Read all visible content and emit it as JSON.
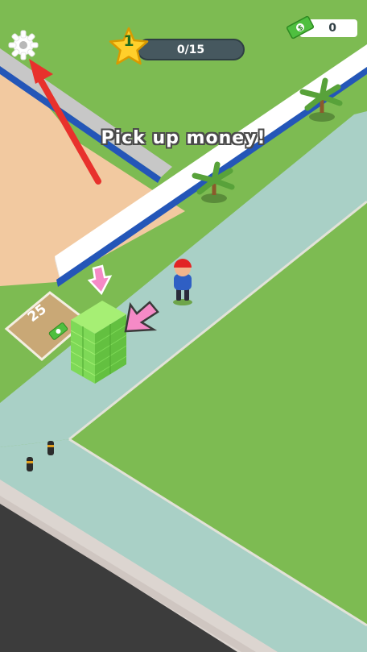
{
  "hud": {
    "level": "1",
    "progress_text": "0/15",
    "progress_fraction": 0.0,
    "cash": "0"
  },
  "hint": {
    "text": "Pick up money!"
  },
  "unlock_pad": {
    "price": "25"
  },
  "icons": {
    "settings": "gear-icon",
    "money": "cash-icon",
    "level": "star-icon"
  },
  "colors": {
    "grass": "#7dbb52",
    "path": "#a9d0c6",
    "sand": "#f2c9a0",
    "wall": "#ffffff",
    "money": "#7ed957",
    "arrow_pink": "#f58ac6",
    "tutorial_arrow": "#e8312c"
  }
}
